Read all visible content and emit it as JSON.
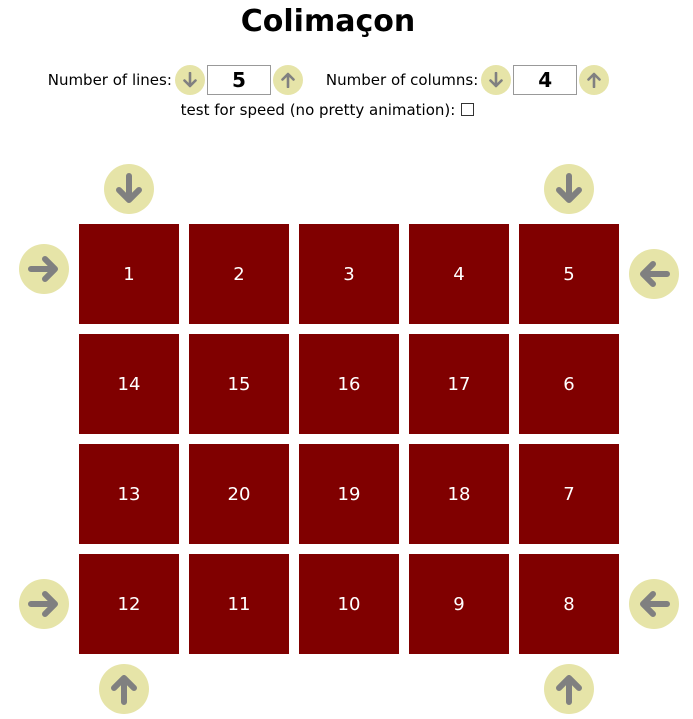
{
  "title": "Colimaçon",
  "controls": {
    "lines_label": "Number of lines:",
    "lines_value": "5",
    "columns_label": "Number of columns:",
    "columns_value": "4",
    "down_icon": "arrow-down-icon",
    "up_icon": "arrow-up-icon"
  },
  "speed": {
    "label": "test for speed (no pretty animation):",
    "checked": false
  },
  "grid": {
    "rows": [
      [
        "1",
        "2",
        "3",
        "4",
        "5"
      ],
      [
        "14",
        "15",
        "16",
        "17",
        "6"
      ],
      [
        "13",
        "20",
        "19",
        "18",
        "7"
      ],
      [
        "12",
        "11",
        "10",
        "9",
        "8"
      ]
    ],
    "cell_color": "#800000",
    "text_color": "#ffffff"
  },
  "arrow_buttons": {
    "top_left": "arrow-down-icon",
    "top_right": "arrow-down-icon",
    "left_top": "arrow-right-icon",
    "right_top": "arrow-left-icon",
    "left_bottom": "arrow-right-icon",
    "right_bottom": "arrow-left-icon",
    "bottom_left": "arrow-up-icon",
    "bottom_right": "arrow-up-icon"
  },
  "colors": {
    "button_bg": "#e6e4a8",
    "arrow_color": "#808080"
  }
}
